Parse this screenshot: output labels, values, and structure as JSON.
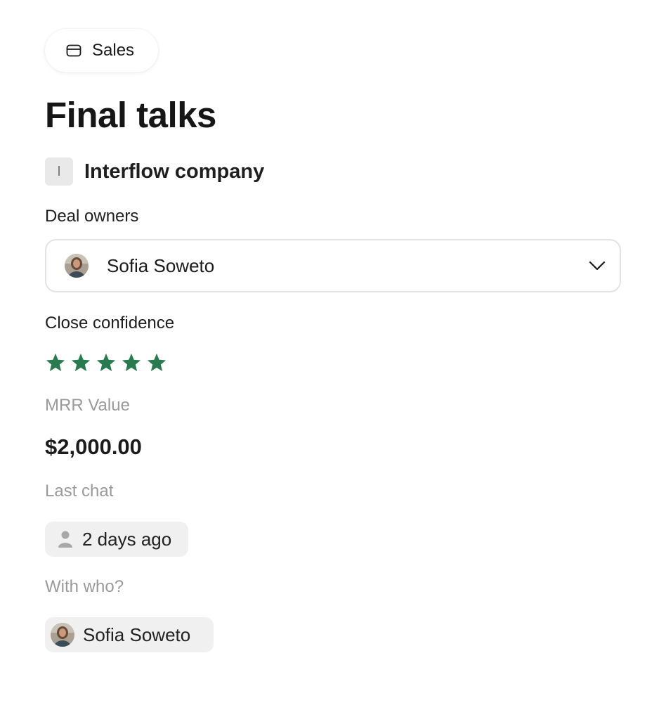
{
  "category": {
    "label": "Sales",
    "icon": "card-icon"
  },
  "title": "Final talks",
  "company": {
    "initial": "I",
    "name": "Interflow company"
  },
  "deal_owners": {
    "label": "Deal owners",
    "selected": "Sofia Soweto",
    "icon": "chevron-down-icon"
  },
  "close_confidence": {
    "label": "Close confidence",
    "rating": 5,
    "max": 5,
    "color": "#2a7a4f"
  },
  "mrr": {
    "label": "MRR Value",
    "value": "$2,000.00"
  },
  "last_chat": {
    "label": "Last chat",
    "value": "2 days ago",
    "icon": "person-icon"
  },
  "with_who": {
    "label": "With who?",
    "name": "Sofia Soweto"
  }
}
